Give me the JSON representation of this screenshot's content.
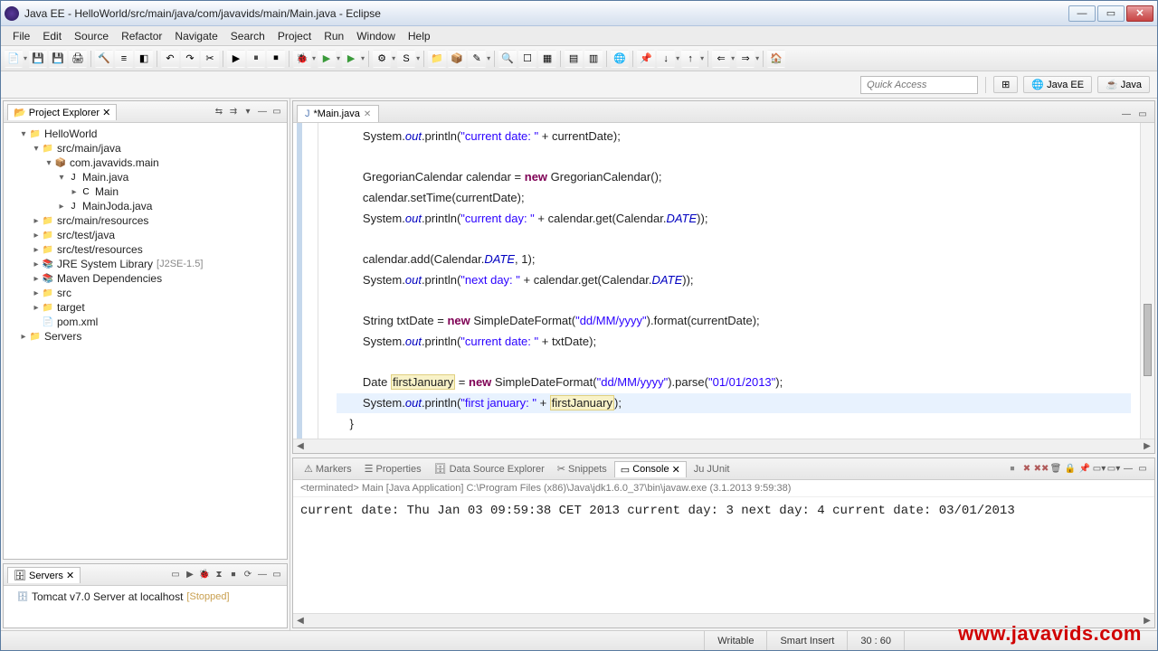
{
  "window": {
    "title": "Java EE - HelloWorld/src/main/java/com/javavids/main/Main.java - Eclipse"
  },
  "menu": {
    "file": "File",
    "edit": "Edit",
    "source": "Source",
    "refactor": "Refactor",
    "navigate": "Navigate",
    "search": "Search",
    "project": "Project",
    "run": "Run",
    "window": "Window",
    "help": "Help"
  },
  "quick_access": {
    "placeholder": "Quick Access"
  },
  "perspectives": {
    "javaee": "Java EE",
    "java": "Java"
  },
  "project_explorer": {
    "title": "Project Explorer",
    "items": [
      {
        "label": "HelloWorld",
        "depth": 1,
        "twist": "▾",
        "ico": "📁"
      },
      {
        "label": "src/main/java",
        "depth": 2,
        "twist": "▾",
        "ico": "📁"
      },
      {
        "label": "com.javavids.main",
        "depth": 3,
        "twist": "▾",
        "ico": "📦"
      },
      {
        "label": "Main.java",
        "depth": 4,
        "twist": "▾",
        "ico": "J"
      },
      {
        "label": "Main",
        "depth": 5,
        "twist": "▸",
        "ico": "C"
      },
      {
        "label": "MainJoda.java",
        "depth": 4,
        "twist": "▸",
        "ico": "J"
      },
      {
        "label": "src/main/resources",
        "depth": 2,
        "twist": "▸",
        "ico": "📁"
      },
      {
        "label": "src/test/java",
        "depth": 2,
        "twist": "▸",
        "ico": "📁"
      },
      {
        "label": "src/test/resources",
        "depth": 2,
        "twist": "▸",
        "ico": "📁"
      },
      {
        "label": "JRE System Library",
        "depth": 2,
        "twist": "▸",
        "ico": "📚",
        "suffix": "[J2SE-1.5]"
      },
      {
        "label": "Maven Dependencies",
        "depth": 2,
        "twist": "▸",
        "ico": "📚"
      },
      {
        "label": "src",
        "depth": 2,
        "twist": "▸",
        "ico": "📁"
      },
      {
        "label": "target",
        "depth": 2,
        "twist": "▸",
        "ico": "📁"
      },
      {
        "label": "pom.xml",
        "depth": 2,
        "twist": "",
        "ico": "📄"
      },
      {
        "label": "Servers",
        "depth": 1,
        "twist": "▸",
        "ico": "📁"
      }
    ]
  },
  "servers_view": {
    "title": "Servers",
    "server": "Tomcat v7.0 Server at localhost",
    "state": "[Stopped]"
  },
  "editor": {
    "tab": "*Main.java",
    "code": {
      "l1a": "        System.",
      "l1b": "out",
      "l1c": ".println(",
      "l1d": "\"current date: \"",
      "l1e": " + currentDate);",
      "l2a": "        GregorianCalendar calendar = ",
      "l2b": "new",
      "l2c": " GregorianCalendar();",
      "l3a": "        calendar.setTime(currentDate);",
      "l4a": "        System.",
      "l4b": "out",
      "l4c": ".println(",
      "l4d": "\"current day: \"",
      "l4e": " + calendar.get(Calendar.",
      "l4f": "DATE",
      "l4g": "));",
      "l5a": "        calendar.add(Calendar.",
      "l5b": "DATE",
      "l5c": ", 1);",
      "l6a": "        System.",
      "l6b": "out",
      "l6c": ".println(",
      "l6d": "\"next day: \"",
      "l6e": " + calendar.get(Calendar.",
      "l6f": "DATE",
      "l6g": "));",
      "l7a": "        String txtDate = ",
      "l7b": "new",
      "l7c": " SimpleDateFormat(",
      "l7d": "\"dd/MM/yyyy\"",
      "l7e": ").format(currentDate);",
      "l8a": "        System.",
      "l8b": "out",
      "l8c": ".println(",
      "l8d": "\"current date: \"",
      "l8e": " + txtDate);",
      "l9a": "        Date ",
      "l9b": "firstJanuary",
      "l9c": " = ",
      "l9d": "new",
      "l9e": " SimpleDateFormat(",
      "l9f": "\"dd/MM/yyyy\"",
      "l9g": ").parse(",
      "l9h": "\"01/01/2013\"",
      "l9i": ");",
      "l10a": "        System.",
      "l10b": "out",
      "l10c": ".println(",
      "l10d": "\"first january: \"",
      "l10e": " + ",
      "l10f": "firstJanuary",
      "l10g": ");",
      "l11a": "    }"
    }
  },
  "bottom": {
    "tabs": {
      "markers": "Markers",
      "properties": "Properties",
      "dse": "Data Source Explorer",
      "snippets": "Snippets",
      "console": "Console",
      "junit": "JUnit"
    },
    "terminated": "<terminated> Main [Java Application] C:\\Program Files (x86)\\Java\\jdk1.6.0_37\\bin\\javaw.exe (3.1.2013 9:59:38)",
    "lines": [
      "current date: Thu Jan 03 09:59:38 CET 2013",
      "current day: 3",
      "next day: 4",
      "current date: 03/01/2013"
    ]
  },
  "status": {
    "writable": "Writable",
    "insert": "Smart Insert",
    "pos": "30 : 60"
  },
  "watermark": "www.javavids.com"
}
